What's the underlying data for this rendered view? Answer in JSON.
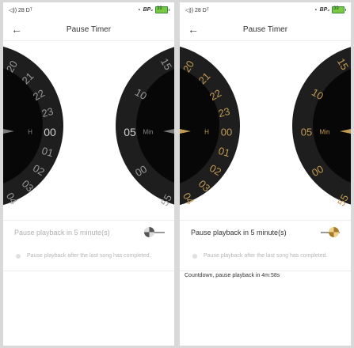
{
  "status_bar": {
    "left": "◁)) 28 Dᵀ",
    "wifi": "wifi-icon",
    "network": "BP₂",
    "battery": "39"
  },
  "header": {
    "back_icon": "arrow-left-icon",
    "title": "Pause Timer"
  },
  "dials": {
    "hour_unit": "H",
    "min_unit": "Min",
    "hour_numbers": [
      "20",
      "21",
      "22",
      "23",
      "00",
      "01",
      "02",
      "03",
      "04"
    ],
    "min_numbers": [
      "15",
      "10",
      "05",
      "00",
      "55"
    ],
    "selected_hour": "00",
    "selected_min": "05"
  },
  "pause_playback_label": "Pause playback in 5 minute(s)",
  "after_song_label": "Pause playback after the last song has completed.",
  "countdown_text": "Countdown, pause playback in 4m:58s",
  "colors": {
    "accent_gold": "#c29a52",
    "dial_ring": "#1e1e1e",
    "dial_center": "#070707",
    "inactive_text": "#9a9a9a"
  }
}
